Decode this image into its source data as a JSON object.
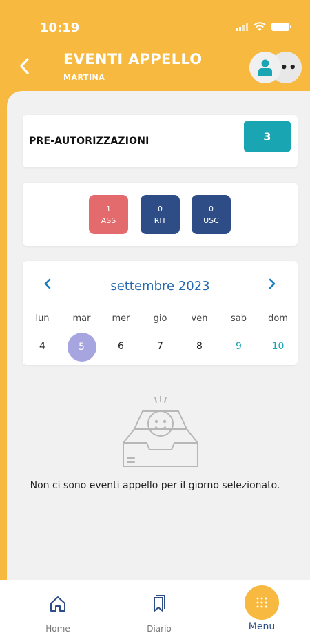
{
  "status_bar": {
    "time": "10:19"
  },
  "header": {
    "title": "EVENTI APPELLO",
    "subtitle": "MARTINA",
    "avatar_more": "••"
  },
  "preauth": {
    "label": "PRE-AUTORIZZAZIONI",
    "count": "3"
  },
  "counts": [
    {
      "value": "1",
      "label": "ASS"
    },
    {
      "value": "0",
      "label": "RIT"
    },
    {
      "value": "0",
      "label": "USC"
    }
  ],
  "calendar": {
    "month": "settembre 2023",
    "days": [
      "lun",
      "mar",
      "mer",
      "gio",
      "ven",
      "sab",
      "dom"
    ],
    "dates": [
      "4",
      "5",
      "6",
      "7",
      "8",
      "9",
      "10"
    ],
    "selected": "5"
  },
  "empty_message": "Non ci sono eventi appello per il giorno selezionato.",
  "nav": {
    "home": "Home",
    "diario": "Diario",
    "menu": "Menu"
  },
  "colors": {
    "brand": "#f7b93f",
    "teal": "#1aa5b3",
    "navy": "#2e4d87",
    "absence_red": "#e36b6e",
    "selected_day": "#a6a5e0"
  }
}
